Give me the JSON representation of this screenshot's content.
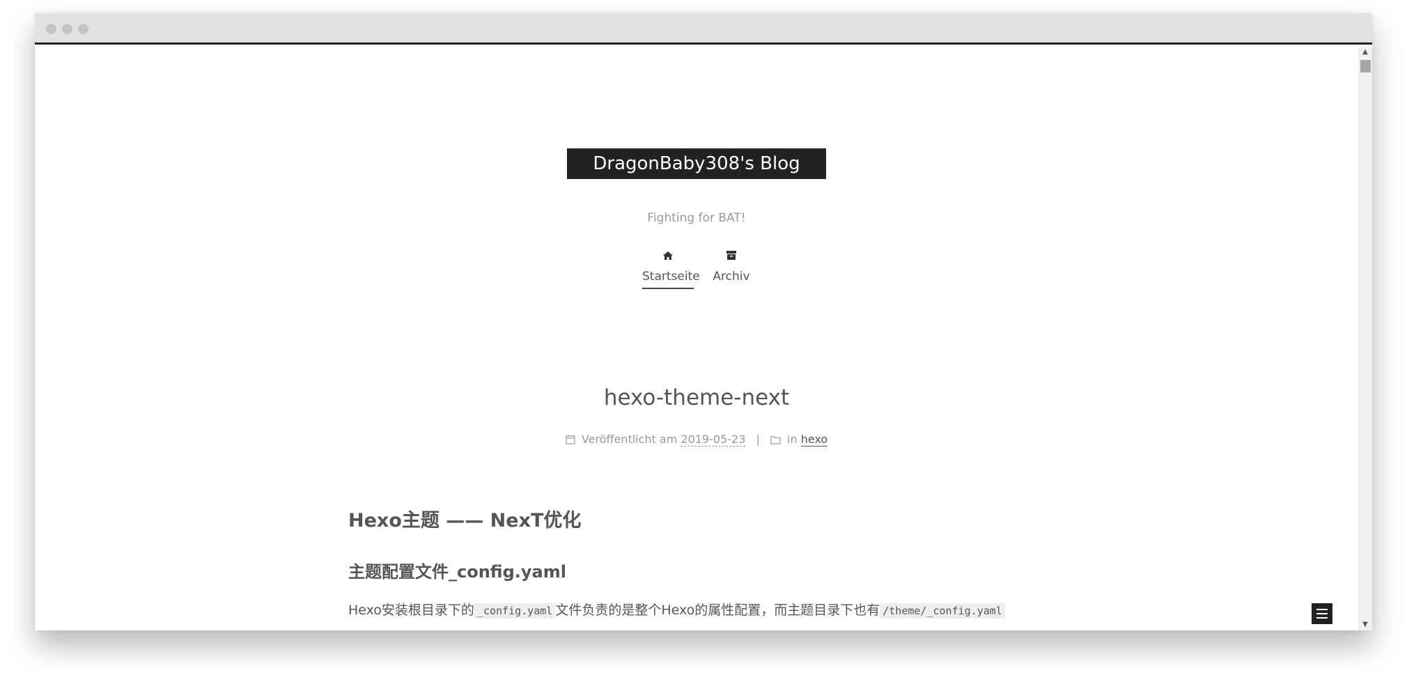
{
  "site": {
    "title": "DragonBaby308's Blog",
    "subtitle": "Fighting for BAT!"
  },
  "nav": {
    "items": [
      {
        "label": "Startseite",
        "icon": "home-icon",
        "active": true
      },
      {
        "label": "Archiv",
        "icon": "archive-icon",
        "active": false
      }
    ]
  },
  "post": {
    "title": "hexo-theme-next",
    "meta": {
      "published_label": "Veröffentlicht am",
      "date": "2019-05-23",
      "separator": "|",
      "in_label": "in",
      "category": "hexo"
    },
    "h1": "Hexo主题 —— NexT优化",
    "h2": "主题配置文件_config.yaml",
    "paragraph": {
      "part1": "Hexo安装根目录下的",
      "code1": "_config.yaml",
      "part2": "文件负责的是整个Hexo的属性配置，而主题目录下也有",
      "code2": "/theme/_config.yaml"
    }
  },
  "colors": {
    "brand_bg": "#222222",
    "text": "#555555",
    "muted": "#999999"
  }
}
